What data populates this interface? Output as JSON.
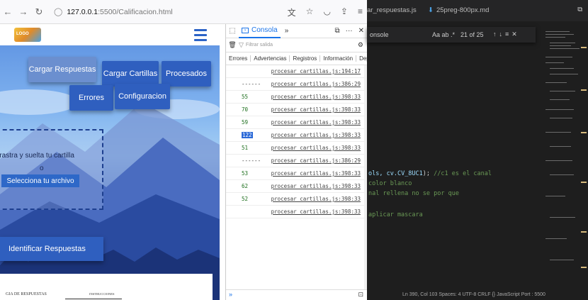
{
  "browser": {
    "url_host": "127.0.0.1",
    "url_path": ":5500/Calificacion.html"
  },
  "page": {
    "menu": {
      "cargar_respuestas": "Cargar Respuestas",
      "cargar_cartillas": "Cargar Cartillas",
      "procesados": "Procesados",
      "errores": "Errores",
      "configuracion": "Configuracion"
    },
    "dropzone": {
      "text": "rrastra y suelta tu cartilla",
      "or": "o",
      "button": "Selecciona tu archivo"
    },
    "identify_button": "Identificar Respuestas",
    "sheet": {
      "title": "GIA DE RESPUESTAS",
      "instructions": "INSTRUCCIONES"
    }
  },
  "devtools": {
    "tab": "Consola",
    "filter_placeholder": "Filtrar salida",
    "levels": [
      "Errores",
      "Advertencias",
      "Registros",
      "Información",
      "Depura"
    ],
    "logs": [
      {
        "value": "",
        "source": "procesar_cartillas.js:194:17",
        "selected": false
      },
      {
        "value": "------",
        "source": "procesar_cartillas.js:386:29",
        "selected": false
      },
      {
        "value": "55",
        "source": "procesar_cartillas.js:398:33",
        "selected": false
      },
      {
        "value": "70",
        "source": "procesar_cartillas.js:398:33",
        "selected": false
      },
      {
        "value": "59",
        "source": "procesar_cartillas.js:398:33",
        "selected": false
      },
      {
        "value": "122",
        "source": "procesar_cartillas.js:398:33",
        "selected": true
      },
      {
        "value": "51",
        "source": "procesar_cartillas.js:398:33",
        "selected": false
      },
      {
        "value": "------",
        "source": "procesar_cartillas.js:386:29",
        "selected": false
      },
      {
        "value": "53",
        "source": "procesar_cartillas.js:398:33",
        "selected": false
      },
      {
        "value": "62",
        "source": "procesar_cartillas.js:398:33",
        "selected": false
      },
      {
        "value": "52",
        "source": "procesar_cartillas.js:398:33",
        "selected": false
      },
      {
        "value": "",
        "source": "procesar_cartillas.js:398:33",
        "selected": false
      }
    ],
    "prompt": "»"
  },
  "editor": {
    "tab1": "ar_respuestas.js",
    "tab2": "25preg-800px.md",
    "find": {
      "query": "onsole",
      "count": "21 of 25"
    },
    "code_lines": [
      {
        "text": "ols, cv.CV_8UC1); //c1 es el canal",
        "color": "#6a9955"
      },
      {
        "text": "color blanco",
        "color": "#6a9955"
      },
      {
        "text": "nal rellena no se por que",
        "color": "#6a9955"
      },
      {
        "text": "aplicar mascara",
        "color": "#6a9955"
      }
    ],
    "status": "Ln 390, Col 103   Spaces: 4   UTF-8   CRLF   {} JavaScript   Port : 5500"
  }
}
